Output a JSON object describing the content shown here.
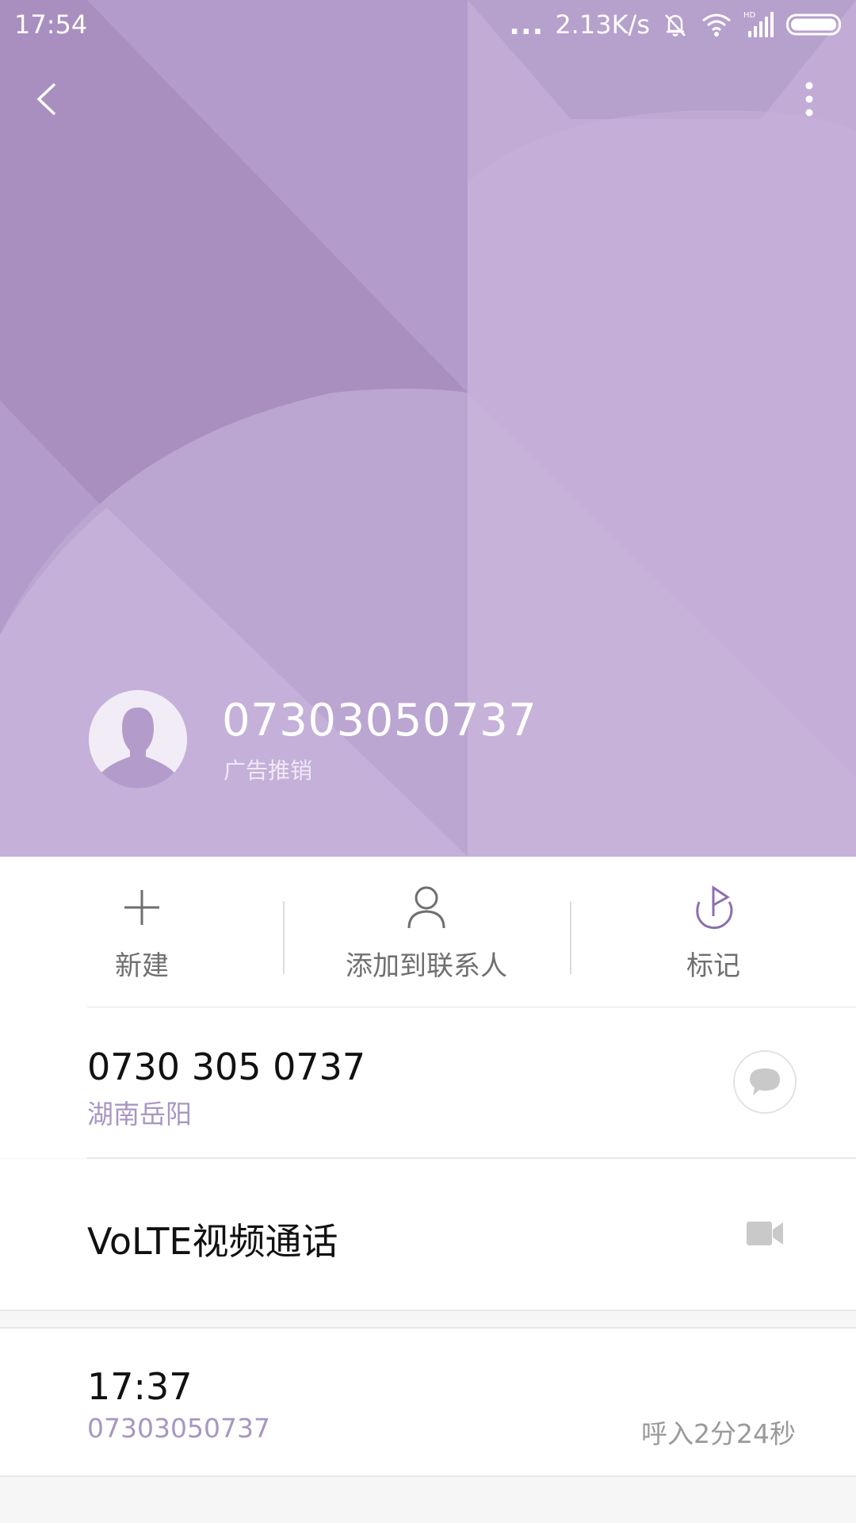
{
  "status_bar": {
    "time": "17:54",
    "dots": "...",
    "net_speed": "2.13K/s",
    "icons": [
      "mute-bell-icon",
      "wifi-icon",
      "hd-signal-icon",
      "battery-icon"
    ]
  },
  "header": {
    "background_color": "#b39ccb",
    "caller_number": "07303050737",
    "caller_tag": "广告推销"
  },
  "actions": [
    {
      "label": "新建",
      "icon": "plus-icon"
    },
    {
      "label": "添加到联系人",
      "icon": "person-icon"
    },
    {
      "label": "标记",
      "icon": "flag-icon"
    }
  ],
  "number_row": {
    "number": "0730 305 0737",
    "location": "湖南岳阳"
  },
  "volte_row": {
    "label": "VoLTE视频通话"
  },
  "call_log": [
    {
      "time": "17:37",
      "number": "07303050737",
      "detail": "呼入2分24秒"
    }
  ],
  "colors": {
    "accent": "#a996c2",
    "text_primary": "#111111",
    "text_secondary": "#6f6f6f"
  }
}
